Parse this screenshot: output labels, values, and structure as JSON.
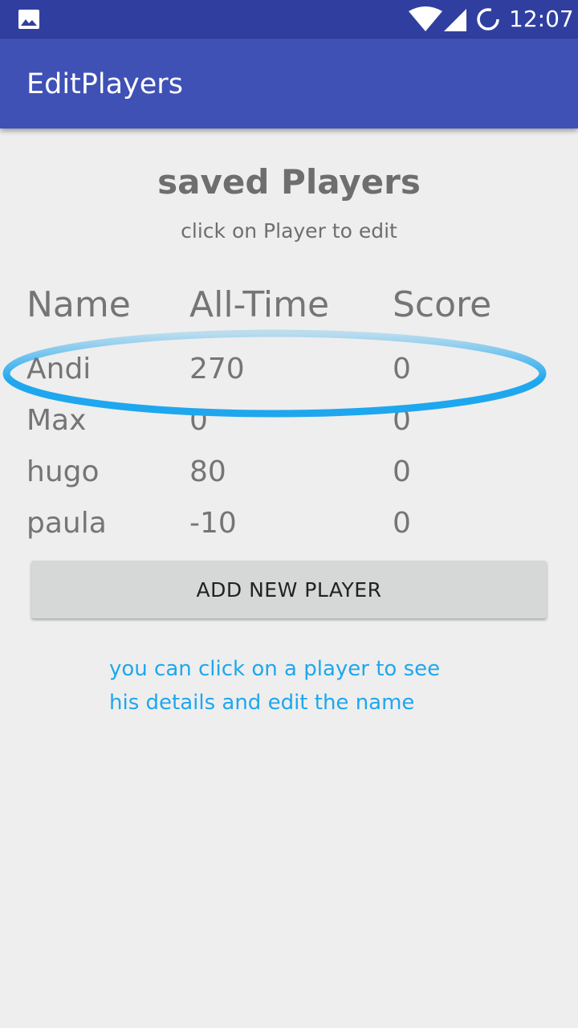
{
  "status_bar": {
    "time": "12:07",
    "icons": [
      "image-icon",
      "wifi-icon",
      "signal-icon",
      "sync-icon"
    ]
  },
  "app_bar": {
    "title": "EditPlayers"
  },
  "main": {
    "title": "saved Players",
    "subtitle": "click on Player to edit"
  },
  "table": {
    "headers": [
      "Name",
      "All-Time",
      "Score"
    ],
    "rows": [
      {
        "name": "Andi",
        "all_time": "270",
        "score": "0"
      },
      {
        "name": "Max",
        "all_time": "0",
        "score": "0"
      },
      {
        "name": "hugo",
        "all_time": "80",
        "score": "0"
      },
      {
        "name": "paula",
        "all_time": "-10",
        "score": "0"
      }
    ]
  },
  "actions": {
    "add_player_label": "ADD NEW PLAYER"
  },
  "hint": {
    "line1": "you can click on a player to see",
    "line2": "his details and edit the name"
  },
  "colors": {
    "status_bar": "#303f9f",
    "app_bar": "#3f51b5",
    "background": "#eeeeee",
    "annotation": "#1ea7ee",
    "button": "#d6d7d7"
  }
}
